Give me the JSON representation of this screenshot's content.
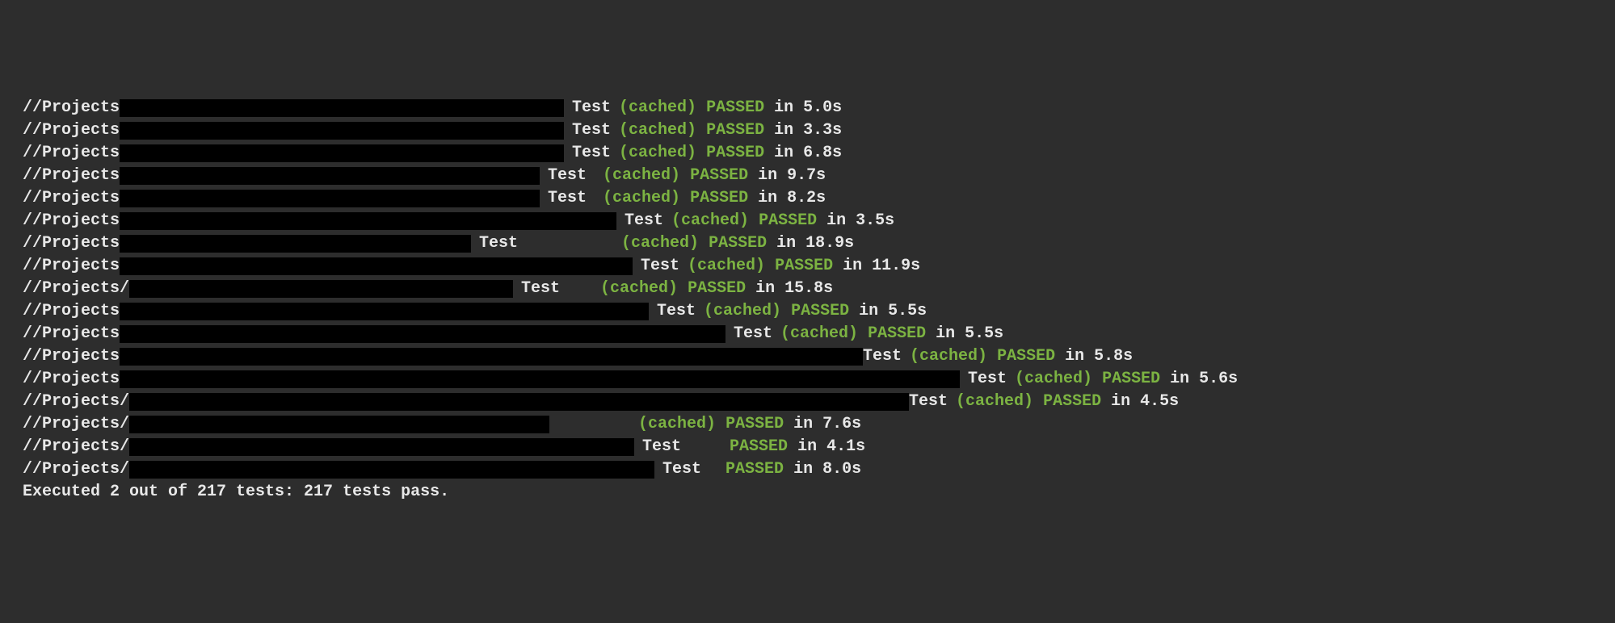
{
  "lines": [
    {
      "prefix": "//Projects",
      "redacted_width": 550,
      "gap_before_test": 10,
      "test_label": "Test",
      "gap_after_test": 10,
      "cached": "(cached)",
      "passed": "PASSED",
      "timing": "in 5.0s"
    },
    {
      "prefix": "//Projects",
      "redacted_width": 550,
      "gap_before_test": 10,
      "test_label": "Test",
      "gap_after_test": 10,
      "cached": "(cached)",
      "passed": "PASSED",
      "timing": "in 3.3s"
    },
    {
      "prefix": "//Projects",
      "redacted_width": 550,
      "gap_before_test": 10,
      "test_label": "Test",
      "gap_after_test": 10,
      "cached": "(cached)",
      "passed": "PASSED",
      "timing": "in 6.8s"
    },
    {
      "prefix": "//Projects",
      "redacted_width": 520,
      "gap_before_test": 10,
      "test_label": "Test",
      "gap_after_test": 20,
      "cached": "(cached)",
      "passed": "PASSED",
      "timing": "in 9.7s"
    },
    {
      "prefix": "//Projects",
      "redacted_width": 520,
      "gap_before_test": 10,
      "test_label": "Test",
      "gap_after_test": 20,
      "cached": "(cached)",
      "passed": "PASSED",
      "timing": "in 8.2s"
    },
    {
      "prefix": "//Projects",
      "redacted_width": 615,
      "gap_before_test": 10,
      "test_label": "Test",
      "gap_after_test": 10,
      "cached": "(cached)",
      "passed": "PASSED",
      "timing": "in 3.5s"
    },
    {
      "prefix": "//Projects",
      "redacted_width": 435,
      "gap_before_test": 10,
      "test_label": "Test",
      "gap_after_test": 128,
      "cached": "(cached)",
      "passed": "PASSED",
      "timing": "in 18.9s"
    },
    {
      "prefix": "//Projects",
      "redacted_width": 635,
      "gap_before_test": 10,
      "test_label": "Test",
      "gap_after_test": 10,
      "cached": "(cached)",
      "passed": "PASSED",
      "timing": "in 11.9s"
    },
    {
      "prefix": "//Projects/",
      "redacted_width": 475,
      "gap_before_test": 10,
      "test_label": "Test",
      "gap_after_test": 50,
      "cached": "(cached)",
      "passed": "PASSED",
      "timing": "in 15.8s"
    },
    {
      "prefix": "//Projects",
      "redacted_width": 655,
      "gap_before_test": 10,
      "test_label": "Test",
      "gap_after_test": 10,
      "cached": "(cached)",
      "passed": "PASSED",
      "timing": "in 5.5s"
    },
    {
      "prefix": "//Projects",
      "redacted_width": 750,
      "gap_before_test": 10,
      "test_label": "Test",
      "gap_after_test": 10,
      "cached": "(cached)",
      "passed": "PASSED",
      "timing": "in 5.5s"
    },
    {
      "prefix": "//Projects",
      "redacted_width": 920,
      "gap_before_test": 0,
      "test_label": "Test",
      "gap_after_test": 10,
      "cached": "(cached)",
      "passed": "PASSED",
      "timing": "in 5.8s"
    },
    {
      "prefix": "//Projects",
      "redacted_width": 1040,
      "gap_before_test": 10,
      "test_label": "Test",
      "gap_after_test": 10,
      "cached": "(cached)",
      "passed": "PASSED",
      "timing": "in 5.6s"
    },
    {
      "prefix": "//Projects/",
      "redacted_width": 965,
      "gap_before_test": 0,
      "test_label": "Test",
      "gap_after_test": 10,
      "cached": "(cached)",
      "passed": "PASSED",
      "timing": "in 4.5s"
    },
    {
      "prefix": "//Projects/",
      "redacted_width": 520,
      "gap_before_test": 100,
      "test_label": "",
      "gap_after_test": 10,
      "cached": "(cached)",
      "passed": "PASSED",
      "timing": "in 7.6s"
    },
    {
      "prefix": "//Projects/",
      "redacted_width": 625,
      "gap_before_test": 10,
      "test_label": "Test",
      "gap_after_test": 60,
      "cached": "",
      "passed": "PASSED",
      "timing": "in 4.1s"
    },
    {
      "prefix": "//Projects/",
      "redacted_width": 650,
      "gap_before_test": 10,
      "test_label": "Test",
      "gap_after_test": 30,
      "cached": "",
      "passed": "PASSED",
      "timing": "in 8.0s"
    }
  ],
  "summary": "Executed 2 out of 217 tests: 217 tests pass."
}
